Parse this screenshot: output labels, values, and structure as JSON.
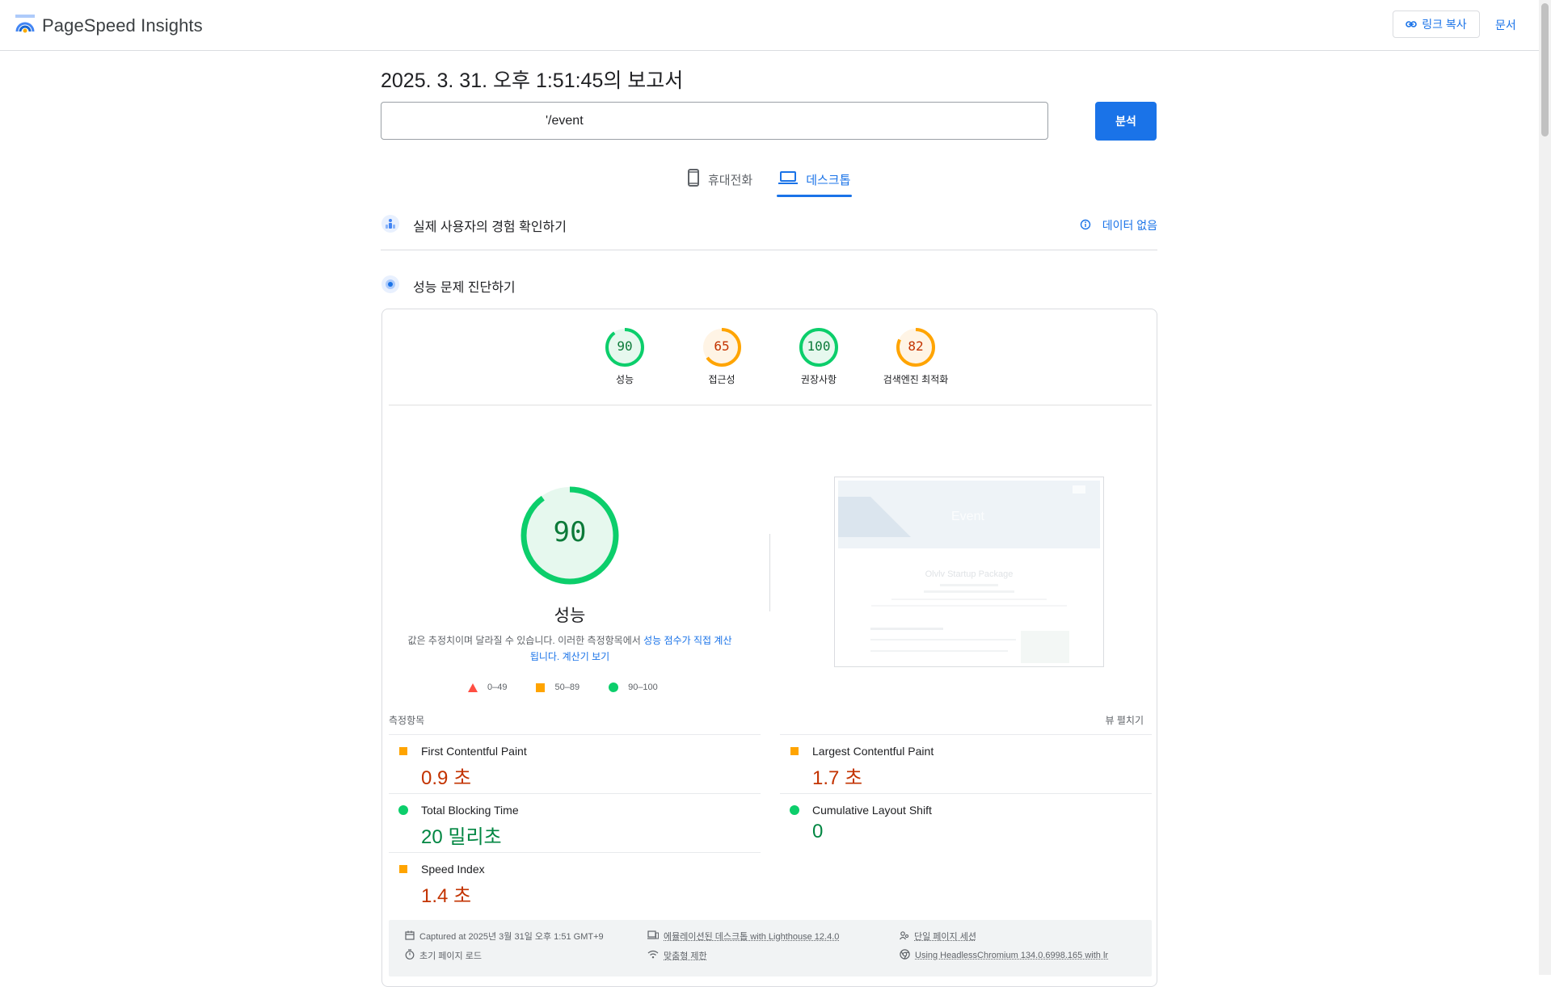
{
  "header": {
    "app_title": "PageSpeed Insights",
    "copy_link_label": "링크 복사",
    "docs_label": "문서"
  },
  "report": {
    "title": "2025. 3. 31. 오후 1:51:45의 보고서",
    "url_value": "'/event",
    "analyze_label": "분석"
  },
  "tabs": [
    {
      "label": "휴대전화",
      "icon": "phone-icon",
      "active": false
    },
    {
      "label": "데스크톱",
      "icon": "laptop-icon",
      "active": true
    }
  ],
  "sections": {
    "field_data_title": "실제 사용자의 경험 확인하기",
    "no_data_label": "데이터 없음",
    "diagnose_title": "성능 문제 진단하기"
  },
  "scores": [
    {
      "label": "성능",
      "value": "90",
      "fraction": 0.9,
      "color": "#0cce6b",
      "text_color": "#0c7a39",
      "bg": "#e6f8ee"
    },
    {
      "label": "접근성",
      "value": "65",
      "fraction": 0.65,
      "color": "#ffa400",
      "text_color": "#c33300",
      "bg": "#fff4e5"
    },
    {
      "label": "권장사항",
      "value": "100",
      "fraction": 1.0,
      "color": "#0cce6b",
      "text_color": "#0c7a39",
      "bg": "#e6f8ee"
    },
    {
      "label": "검색엔진 최적화",
      "value": "82",
      "fraction": 0.82,
      "color": "#ffa400",
      "text_color": "#c33300",
      "bg": "#fff4e5"
    }
  ],
  "performance": {
    "score": "90",
    "fraction": 0.9,
    "label": "성능",
    "disclaimer_prefix": "값은 추정치이며 달라질 수 있습니다. 이러한 측정항목에서 ",
    "disclaimer_link": "성능 점수가 직접 계산됩니다.",
    "calc_link": "계산기 보기"
  },
  "legend": [
    {
      "range": "0–49",
      "shape": "triangle",
      "color": "#ff4e42"
    },
    {
      "range": "50–89",
      "shape": "square",
      "color": "#ffa400"
    },
    {
      "range": "90–100",
      "shape": "circle",
      "color": "#0cce6b"
    }
  ],
  "screenshot": {
    "hero_text": "Event",
    "sub_text": "Olvlv Startup Package"
  },
  "metrics_section": {
    "label": "측정항목",
    "expand_label": "뷰 펼치기"
  },
  "metrics": [
    {
      "name": "First Contentful Paint",
      "value": "0.9 초",
      "status": "average"
    },
    {
      "name": "Largest Contentful Paint",
      "value": "1.7 초",
      "status": "average"
    },
    {
      "name": "Total Blocking Time",
      "value": "20 밀리초",
      "status": "pass"
    },
    {
      "name": "Cumulative Layout Shift",
      "value": "0",
      "status": "pass"
    },
    {
      "name": "Speed Index",
      "value": "1.4 초",
      "status": "average"
    }
  ],
  "footer": {
    "captured": "Captured at 2025년 3월 31일 오후 1:51 GMT+9",
    "initial_load": "초기 페이지 로드",
    "emulated": "에뮬레이션된 데스크톱 with Lighthouse 12.4.0",
    "throttling": "맞춤형 제한",
    "session": "단일 페이지 세션",
    "browser": "Using HeadlessChromium 134.0.6998.165 with lr"
  },
  "colors": {
    "accent": "#1a73e8",
    "pass": "#0cce6b",
    "average": "#ffa400",
    "fail": "#ff4e42"
  }
}
